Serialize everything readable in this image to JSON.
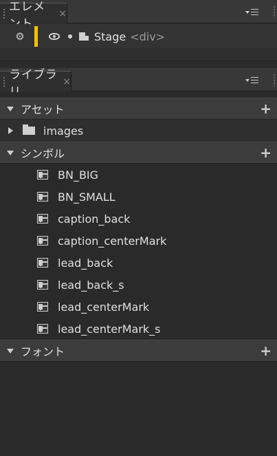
{
  "elements_panel": {
    "tab_title": "エレメント",
    "tab_close": "×",
    "stage_label": "Stage",
    "stage_tag": "<div>"
  },
  "library_panel": {
    "tab_title": "ライブラリ",
    "tab_close": "×",
    "sections": {
      "assets": {
        "label": "アセット",
        "add": "+"
      },
      "symbols": {
        "label": "シンボル",
        "add": "+"
      },
      "fonts": {
        "label": "フォント",
        "add": "+"
      }
    },
    "folders": [
      {
        "label": "images"
      }
    ],
    "symbols": [
      {
        "label": "BN_BIG"
      },
      {
        "label": "BN_SMALL"
      },
      {
        "label": "caption_back"
      },
      {
        "label": "caption_centerMark"
      },
      {
        "label": "lead_back"
      },
      {
        "label": "lead_back_s"
      },
      {
        "label": "lead_centerMark"
      },
      {
        "label": "lead_centerMark_s"
      }
    ]
  },
  "colors": {
    "panel_bg": "#2b2b2b",
    "accent_yellow": "#f2c200"
  }
}
